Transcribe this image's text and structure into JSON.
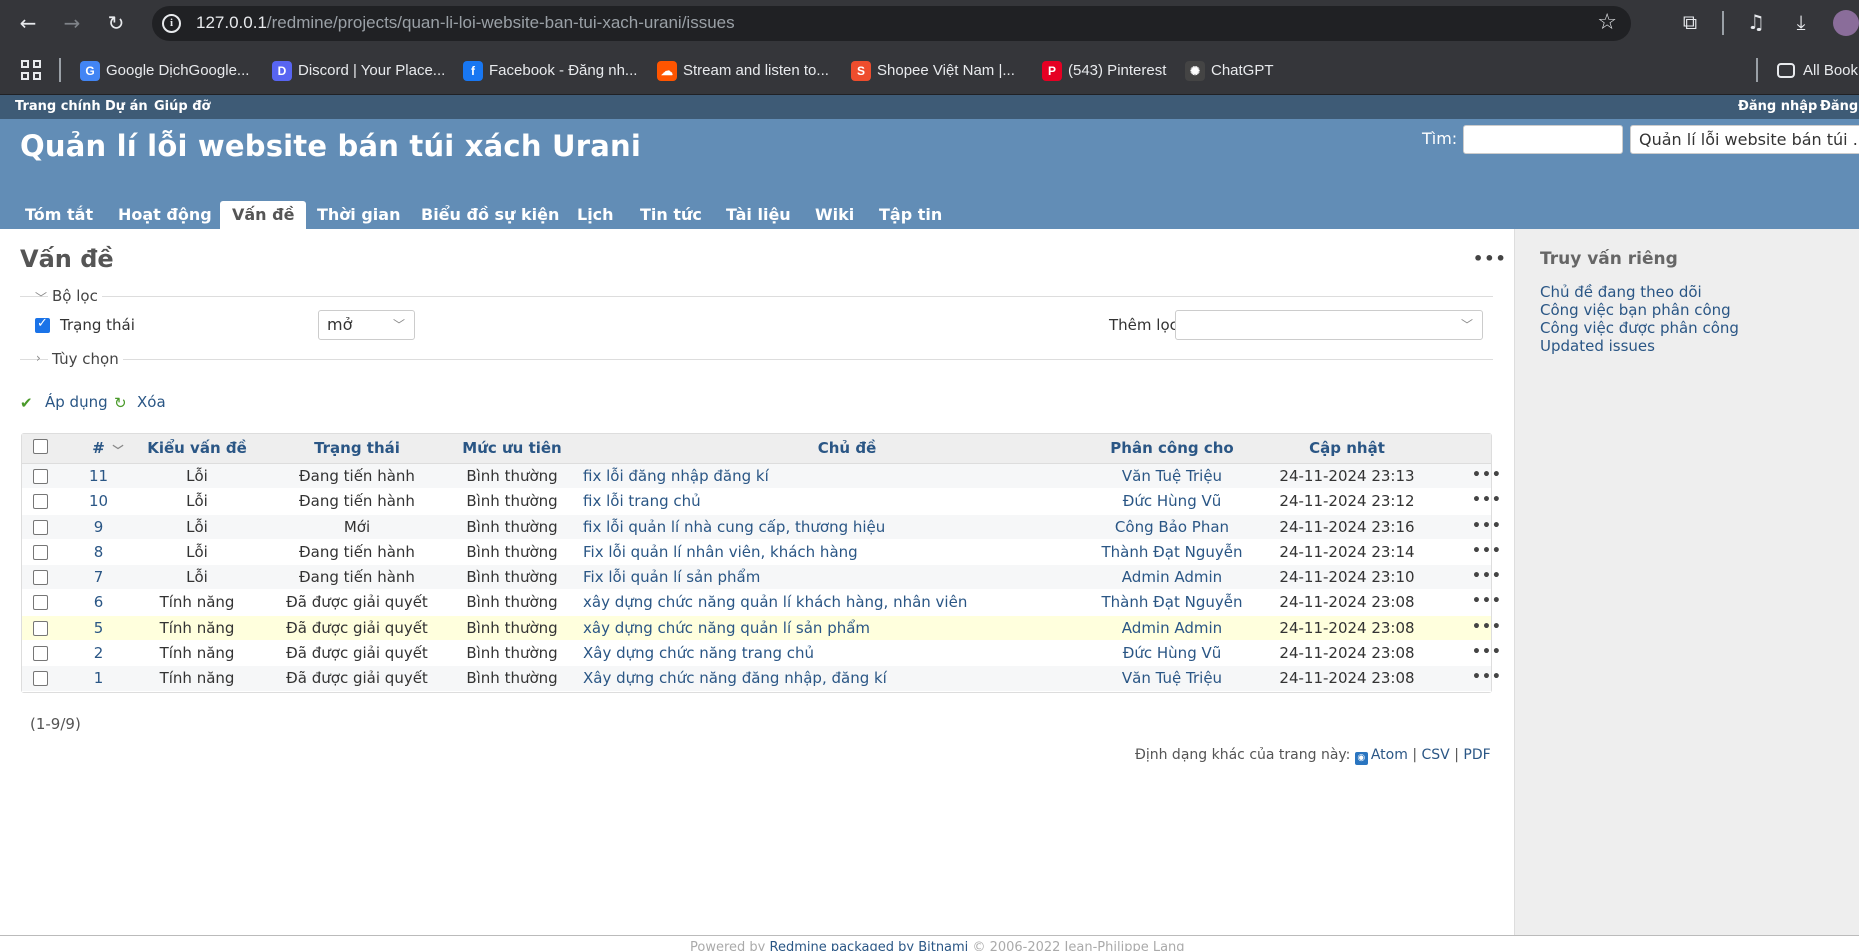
{
  "browser": {
    "url_host": "127.0.0.1",
    "url_path": "/redmine/projects/quan-li-loi-website-ban-tui-xach-urani/issues",
    "bookmarks": [
      {
        "label": "Google DịchGoogle...",
        "color": "#4285f4",
        "glyph": "G"
      },
      {
        "label": "Discord | Your Place...",
        "color": "#5865f2",
        "glyph": "D"
      },
      {
        "label": "Facebook - Đăng nh...",
        "color": "#1877f2",
        "glyph": "f"
      },
      {
        "label": "Stream and listen to...",
        "color": "#ff5500",
        "glyph": "☁"
      },
      {
        "label": "Shopee Việt Nam |...",
        "color": "#ee4d2d",
        "glyph": "S"
      },
      {
        "label": "(543) Pinterest",
        "color": "#e60023",
        "glyph": "P"
      },
      {
        "label": "ChatGPT",
        "color": "#444",
        "glyph": "✺"
      }
    ],
    "all_bookmarks": "All Book"
  },
  "top_menu": {
    "home": "Trang chính",
    "projects": "Dự án",
    "help": "Giúp đỡ",
    "login": "Đăng nhập",
    "register": "Đăng"
  },
  "header": {
    "title": "Quản lí lỗi website bán túi xách Urani",
    "search_label": "Tìm:",
    "project_jump": "Quản lí lỗi website bán túi ..."
  },
  "tabs": [
    "Tóm tắt",
    "Hoạt động",
    "Vấn đề",
    "Thời gian",
    "Biểu đồ sự kiện",
    "Lịch",
    "Tin tức",
    "Tài liệu",
    "Wiki",
    "Tập tin"
  ],
  "content": {
    "title": "Vấn đề",
    "filters_legend": "Bộ lọc",
    "filter_status_label": "Trạng thái",
    "filter_status_value": "mở",
    "add_filter_label": "Thêm lọc",
    "options_legend": "Tùy chọn",
    "apply": "Áp dụng",
    "clear": "Xóa"
  },
  "table": {
    "headers": [
      "#",
      "Kiểu vấn đề",
      "Trạng thái",
      "Mức ưu tiên",
      "Chủ đề",
      "Phân công cho",
      "Cập nhật"
    ],
    "rows": [
      {
        "id": "11",
        "tracker": "Lỗi",
        "status": "Đang tiến hành",
        "priority": "Bình thường",
        "subject": "fix lỗi đăng nhập đăng kí",
        "assignee": "Văn Tuệ Triệu",
        "updated": "24-11-2024 23:13"
      },
      {
        "id": "10",
        "tracker": "Lỗi",
        "status": "Đang tiến hành",
        "priority": "Bình thường",
        "subject": "fix lỗi trang chủ",
        "assignee": "Đức Hùng Vũ",
        "updated": "24-11-2024 23:12"
      },
      {
        "id": "9",
        "tracker": "Lỗi",
        "status": "Mới",
        "priority": "Bình thường",
        "subject": "fix lỗi quản lí nhà cung cấp, thương hiệu",
        "assignee": "Công Bảo Phan",
        "updated": "24-11-2024 23:16"
      },
      {
        "id": "8",
        "tracker": "Lỗi",
        "status": "Đang tiến hành",
        "priority": "Bình thường",
        "subject": "Fix lỗi quản lí nhân viên, khách hàng",
        "assignee": "Thành Đạt Nguyễn",
        "updated": "24-11-2024 23:14"
      },
      {
        "id": "7",
        "tracker": "Lỗi",
        "status": "Đang tiến hành",
        "priority": "Bình thường",
        "subject": "Fix lỗi quản lí sản phẩm",
        "assignee": "Admin Admin",
        "updated": "24-11-2024 23:10"
      },
      {
        "id": "6",
        "tracker": "Tính năng",
        "status": "Đã được giải quyết",
        "priority": "Bình thường",
        "subject": "xây dựng chức năng quản lí khách hàng, nhân viên",
        "assignee": "Thành Đạt Nguyễn",
        "updated": "24-11-2024 23:08"
      },
      {
        "id": "5",
        "tracker": "Tính năng",
        "status": "Đã được giải quyết",
        "priority": "Bình thường",
        "subject": "xây dựng chức năng quản lí sản phẩm",
        "assignee": "Admin Admin",
        "updated": "24-11-2024 23:08"
      },
      {
        "id": "2",
        "tracker": "Tính năng",
        "status": "Đã được giải quyết",
        "priority": "Bình thường",
        "subject": "Xây dựng chức năng trang chủ",
        "assignee": "Đức Hùng Vũ",
        "updated": "24-11-2024 23:08"
      },
      {
        "id": "1",
        "tracker": "Tính năng",
        "status": "Đã được giải quyết",
        "priority": "Bình thường",
        "subject": "Xây dựng chức năng đăng nhập, đăng kí",
        "assignee": "Văn Tuệ Triệu",
        "updated": "24-11-2024 23:08"
      }
    ]
  },
  "pager": "(1-9/9)",
  "formats": {
    "label": "Định dạng khác của trang này:",
    "atom": "Atom",
    "csv": "CSV",
    "pdf": "PDF",
    "sep": "|"
  },
  "sidebar": {
    "title": "Truy vấn riêng",
    "links": [
      "Chủ đề đang theo dõi",
      "Công việc bạn phân công",
      "Công việc được phân công",
      "Updated issues"
    ]
  },
  "footer": {
    "prefix": "Powered by",
    "link": "Redmine packaged by Bitnami",
    "suffix": "© 2006-2022 Jean-Philippe Lang"
  }
}
